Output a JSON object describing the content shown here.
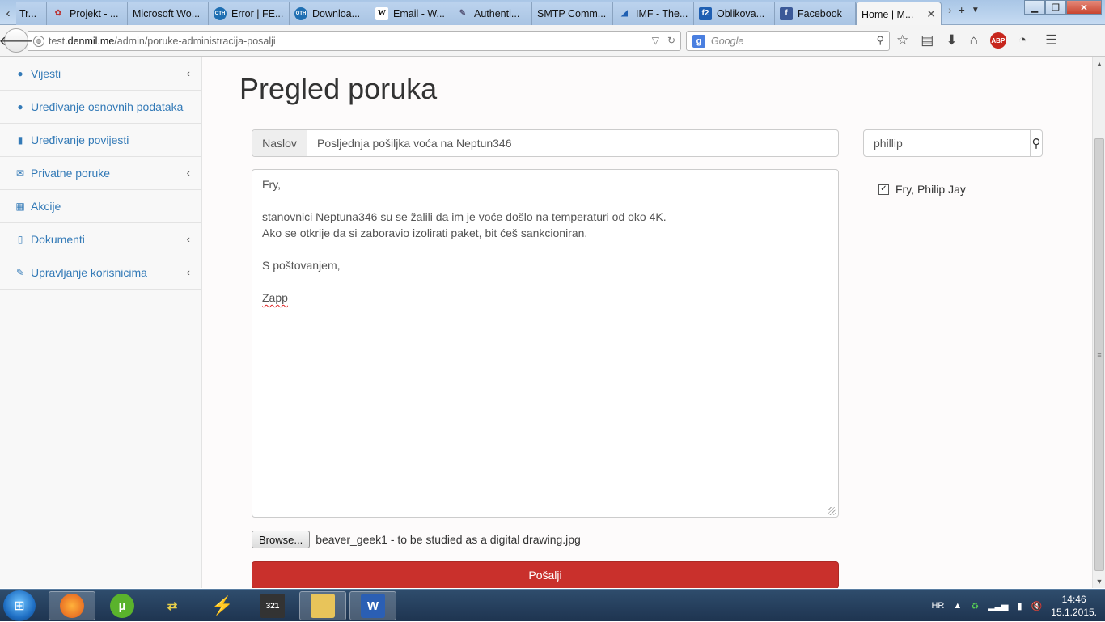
{
  "browser": {
    "tabs": [
      {
        "label": "Tr...",
        "icon": "app-icon"
      },
      {
        "label": "Projekt - ...",
        "icon": "projekt-icon"
      },
      {
        "label": "Microsoft Wo...",
        "icon": ""
      },
      {
        "label": "Error | FE...",
        "icon": "oth-icon"
      },
      {
        "label": "Downloa...",
        "icon": "oth-icon"
      },
      {
        "label": "Email - W...",
        "icon": "wikipedia-icon"
      },
      {
        "label": "Authenti...",
        "icon": "document-icon"
      },
      {
        "label": "SMTP Comm...",
        "icon": ""
      },
      {
        "label": "IMF - The...",
        "icon": "imf-icon"
      },
      {
        "label": "Oblikova...",
        "icon": "f2-icon"
      },
      {
        "label": "Facebook",
        "icon": "facebook-icon"
      }
    ],
    "active_tab": {
      "label": "Home | M..."
    },
    "url": {
      "prefix": "test.",
      "host": "denmil.me",
      "path": "/admin/poruke-administracija-posalji"
    },
    "search_placeholder": "Google"
  },
  "sidebar": {
    "items": [
      {
        "label": "Vijesti",
        "icon": "info-icon",
        "has_chevron": true
      },
      {
        "label": "Uređivanje osnovnih podataka",
        "icon": "info-icon",
        "has_chevron": false
      },
      {
        "label": "Uređivanje povijesti",
        "icon": "book-icon",
        "has_chevron": false
      },
      {
        "label": "Privatne poruke",
        "icon": "envelope-icon",
        "has_chevron": true
      },
      {
        "label": "Akcije",
        "icon": "calendar-icon",
        "has_chevron": false
      },
      {
        "label": "Dokumenti",
        "icon": "file-icon",
        "has_chevron": true
      },
      {
        "label": "Upravljanje korisnicima",
        "icon": "wrench-icon",
        "has_chevron": true
      }
    ]
  },
  "main": {
    "title": "Pregled poruka",
    "subject_label": "Naslov",
    "subject_value": "Posljednja pošiljka voća na Neptun346",
    "body": {
      "line1": "Fry,",
      "line2": "stanovnici Neptuna346 su se žalili da im je voće došlo na temperaturi od oko 4K.",
      "line3": "Ako se otkrije da si zaboravio izolirati paket, bit ćeš sankcioniran.",
      "line4": "S poštovanjem,",
      "line5": "Zapp"
    },
    "browse_label": "Browse...",
    "file_name": "beaver_geek1 - to be studied as a digital drawing.jpg",
    "send_label": "Pošalji"
  },
  "recipients": {
    "search_value": "phillip",
    "items": [
      {
        "label": "Fry, Philip Jay",
        "checked": true
      }
    ]
  },
  "taskbar": {
    "language": "HR",
    "time": "14:46",
    "date": "15.1.2015."
  },
  "colors": {
    "link": "#337ab7",
    "danger": "#c9302c",
    "sidebar_bg": "#f8f8f8"
  }
}
